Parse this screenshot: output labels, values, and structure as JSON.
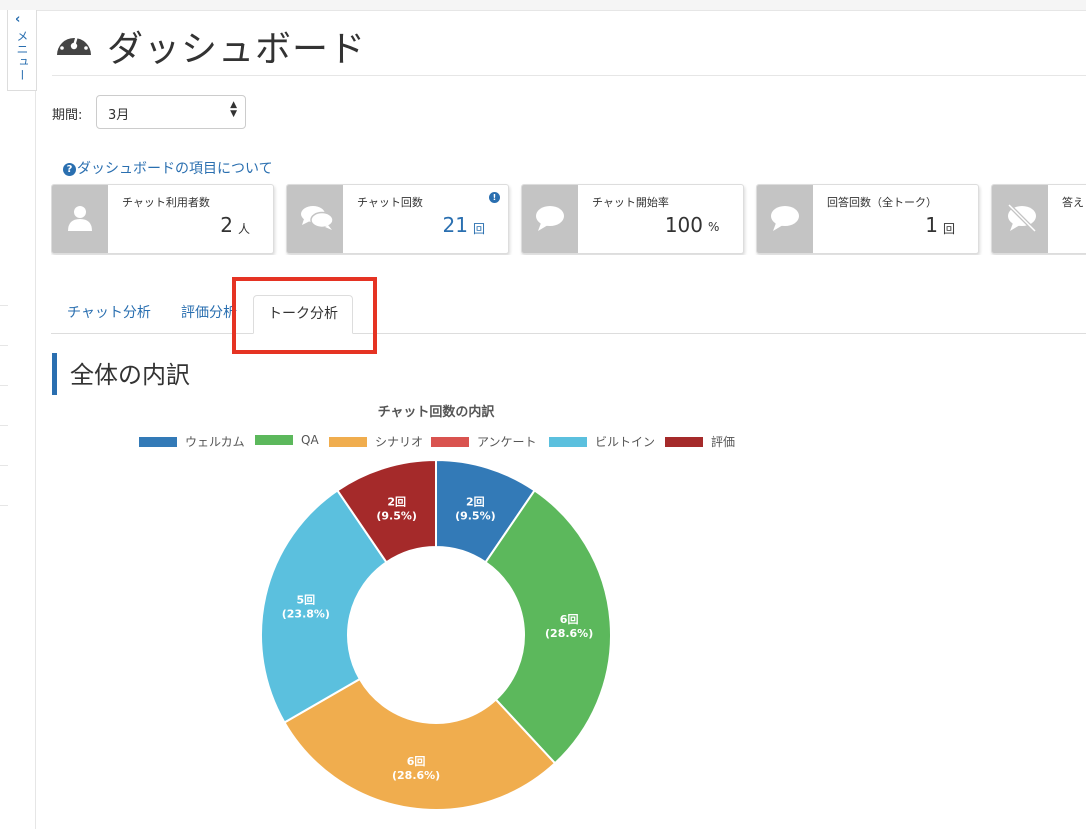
{
  "menu": {
    "label": "メニュー"
  },
  "header": {
    "title": "ダッシュボード"
  },
  "period": {
    "label": "期間:",
    "value": "3月"
  },
  "about_link": "ダッシュボードの項目について",
  "cards": [
    {
      "label": "チャット利用者数",
      "value": "2",
      "unit": "人",
      "icon": "user-icon"
    },
    {
      "label": "チャット回数",
      "value": "21",
      "unit": "回",
      "icon": "chat-bubbles-icon"
    },
    {
      "label": "チャット開始率",
      "value": "100",
      "unit": "%",
      "icon": "chat-bubble-icon"
    },
    {
      "label": "回答回数（全トーク）",
      "value": "1",
      "unit": "回",
      "icon": "chat-bubble-icon"
    },
    {
      "label": "答え",
      "value": "",
      "unit": "",
      "icon": "chat-off-icon"
    }
  ],
  "tabs": [
    "チャット分析",
    "評価分析",
    "トーク分析"
  ],
  "active_tab": "トーク分析",
  "section_title": "全体の内訳",
  "chart_data": {
    "type": "pie",
    "title": "チャット回数の内訳",
    "legend_position": "top",
    "categories": [
      "ウェルカム",
      "QA",
      "シナリオ",
      "アンケート",
      "ビルトイン",
      "評価"
    ],
    "values": [
      2,
      6,
      6,
      0,
      5,
      2
    ],
    "labels": [
      "2回\n(9.5%)",
      "6回\n(28.6%)",
      "6回\n(28.6%)",
      "",
      "5回\n(23.8%)",
      "2回\n(9.5%)"
    ],
    "colors": [
      "#337ab7",
      "#5cb85c",
      "#f0ad4e",
      "#d9534f",
      "#5bc0de",
      "#a52a2a"
    ]
  }
}
